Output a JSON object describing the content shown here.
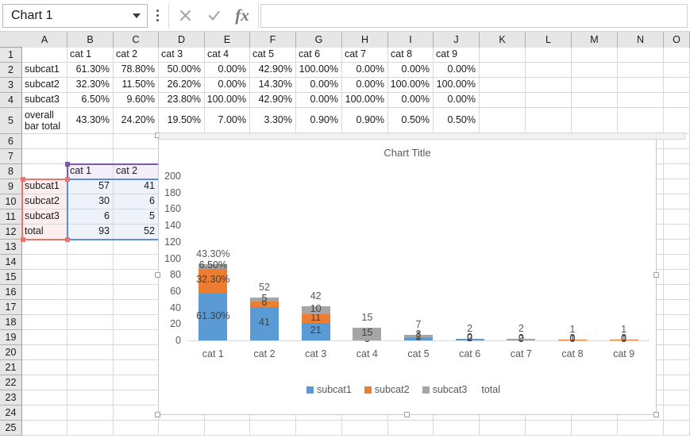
{
  "formula_bar": {
    "name_box_value": "Chart 1",
    "name_box_caret_icon": "chevron-down-icon",
    "kebab_icon": "more-options-icon",
    "cancel_icon": "cancel-x-icon",
    "confirm_icon": "confirm-check-icon",
    "function_icon": "fx-insert-function-icon",
    "formula_value": "",
    "formula_placeholder": ""
  },
  "grid": {
    "column_headers": [
      "A",
      "B",
      "C",
      "D",
      "E",
      "F",
      "G",
      "H",
      "I",
      "J",
      "K",
      "L",
      "M",
      "N",
      "O"
    ],
    "row_headers": [
      "1",
      "2",
      "3",
      "4",
      "5",
      "6",
      "7",
      "8",
      "9",
      "10",
      "11",
      "12",
      "13",
      "14",
      "15",
      "16",
      "17",
      "18",
      "19",
      "20",
      "21",
      "22",
      "23",
      "24",
      "25"
    ],
    "table_percent": {
      "header_row": [
        "",
        "cat 1",
        "cat 2",
        "cat 3",
        "cat 4",
        "cat 5",
        "cat 6",
        "cat 7",
        "cat 8",
        "cat 9"
      ],
      "rows": [
        {
          "label": "subcat1",
          "values": [
            "61.30%",
            "78.80%",
            "50.00%",
            "0.00%",
            "42.90%",
            "100.00%",
            "0.00%",
            "0.00%",
            "0.00%"
          ]
        },
        {
          "label": "subcat2",
          "values": [
            "32.30%",
            "11.50%",
            "26.20%",
            "0.00%",
            "14.30%",
            "0.00%",
            "0.00%",
            "100.00%",
            "100.00%"
          ]
        },
        {
          "label": "subcat3",
          "values": [
            "6.50%",
            "9.60%",
            "23.80%",
            "100.00%",
            "42.90%",
            "0.00%",
            "100.00%",
            "0.00%",
            "0.00%"
          ]
        },
        {
          "label": "overall bar total",
          "values": [
            "43.30%",
            "24.20%",
            "19.50%",
            "7.00%",
            "3.30%",
            "0.90%",
            "0.90%",
            "0.50%",
            "0.50%"
          ]
        }
      ]
    },
    "table_counts": {
      "header_row": [
        "",
        "cat 1",
        "cat 2"
      ],
      "rows": [
        {
          "label": "subcat1",
          "values": [
            "57",
            "41"
          ]
        },
        {
          "label": "subcat2",
          "values": [
            "30",
            "6"
          ]
        },
        {
          "label": "subcat3",
          "values": [
            "6",
            "5"
          ]
        },
        {
          "label": "total",
          "values": [
            "93",
            "52"
          ]
        }
      ]
    },
    "selection_colors": {
      "label_range": "#e8756f",
      "value_range": "#5b8fd4",
      "header_range": "#7d56ad"
    }
  },
  "chart_data": {
    "type": "bar",
    "stacked": true,
    "title": "Chart Title",
    "xlabel": "",
    "ylabel": "",
    "ylim": [
      0,
      200
    ],
    "ytick_values": [
      "0",
      "20",
      "40",
      "60",
      "80",
      "100",
      "120",
      "140",
      "160",
      "180",
      "200"
    ],
    "grid": false,
    "legend_position": "bottom",
    "categories": [
      "cat 1",
      "cat 2",
      "cat 3",
      "cat 4",
      "cat 5",
      "cat 6",
      "cat 7",
      "cat 8",
      "cat 9"
    ],
    "series": [
      {
        "name": "subcat1",
        "color": "#5b9bd5",
        "values": [
          57,
          41,
          21,
          0,
          3,
          2,
          0,
          0,
          0
        ],
        "labels": [
          "61.30%",
          "41",
          "21",
          "0",
          "3",
          "2",
          "0",
          "0",
          "0"
        ]
      },
      {
        "name": "subcat2",
        "color": "#ed7d31",
        "values": [
          30,
          6,
          11,
          0,
          1,
          0,
          0,
          1,
          1
        ],
        "labels": [
          "32.30%",
          "6",
          "11",
          "0",
          "1",
          "0",
          "0",
          "1",
          "1"
        ]
      },
      {
        "name": "subcat3",
        "color": "#a5a5a5",
        "values": [
          6,
          5,
          10,
          15,
          3,
          0,
          2,
          0,
          0
        ],
        "labels": [
          "6.50%",
          "5",
          "10",
          "15",
          "3",
          "0",
          "2",
          "0",
          "0"
        ]
      },
      {
        "name": "total",
        "color": "#595959",
        "values": [
          93,
          52,
          42,
          15,
          7,
          2,
          2,
          1,
          1
        ],
        "labels": [
          "43.30%",
          "52",
          "42",
          "15",
          "7",
          "2",
          "2",
          "1",
          "1"
        ]
      }
    ],
    "legend_entries": [
      {
        "label": "subcat1",
        "color": "#5b9bd5",
        "marker": true
      },
      {
        "label": "subcat2",
        "color": "#ed7d31",
        "marker": true
      },
      {
        "label": "subcat3",
        "color": "#a5a5a5",
        "marker": true
      },
      {
        "label": "total",
        "color": "#595959",
        "marker": false
      }
    ]
  }
}
